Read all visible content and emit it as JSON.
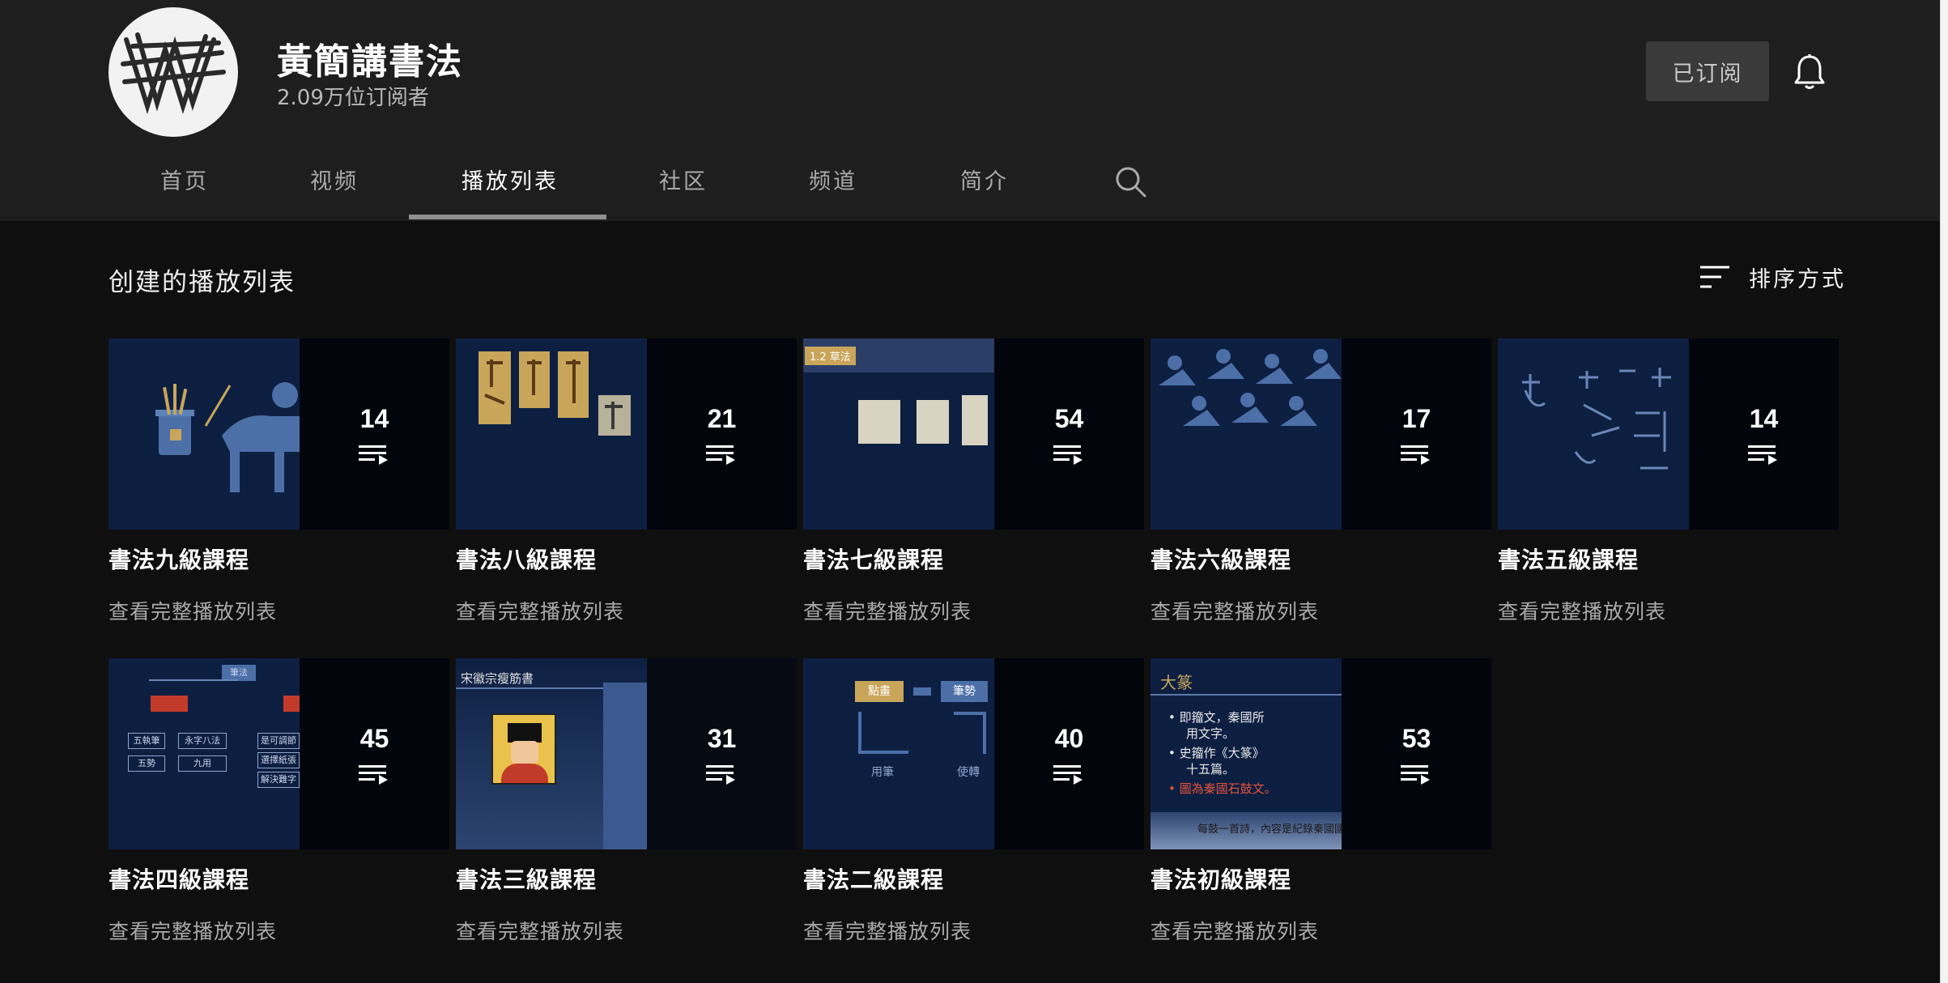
{
  "channel": {
    "name": "黃簡講書法",
    "subscribers": "2.09万位订阅者",
    "subscribed_label": "已订阅"
  },
  "tabs": [
    {
      "label": "首页",
      "active": false
    },
    {
      "label": "视频",
      "active": false
    },
    {
      "label": "播放列表",
      "active": true
    },
    {
      "label": "社区",
      "active": false
    },
    {
      "label": "频道",
      "active": false
    },
    {
      "label": "简介",
      "active": false
    }
  ],
  "icons": {
    "tab_search": "search-icon",
    "bell": "bell-icon",
    "sort": "sort-icon",
    "playlist": "playlist-icon"
  },
  "section": {
    "title": "创建的播放列表",
    "sort_label": "排序方式"
  },
  "playlists": [
    {
      "title": "書法九級課程",
      "count": "14",
      "link": "查看完整播放列表"
    },
    {
      "title": "書法八級課程",
      "count": "21",
      "link": "查看完整播放列表"
    },
    {
      "title": "書法七級課程",
      "count": "54",
      "link": "查看完整播放列表"
    },
    {
      "title": "書法六級課程",
      "count": "17",
      "link": "查看完整播放列表"
    },
    {
      "title": "書法五級課程",
      "count": "14",
      "link": "查看完整播放列表"
    },
    {
      "title": "書法四級課程",
      "count": "45",
      "link": "查看完整播放列表"
    },
    {
      "title": "書法三級課程",
      "count": "31",
      "link": "查看完整播放列表"
    },
    {
      "title": "書法二級課程",
      "count": "40",
      "link": "查看完整播放列表"
    },
    {
      "title": "書法初級課程",
      "count": "53",
      "link": "查看完整播放列表"
    }
  ],
  "thumb_text": {
    "p7_header": "1.2 草法",
    "p4_root": "筆法",
    "p4_a": "五執筆",
    "p4_b": "永字八法",
    "p4_c": "五勢",
    "p4_d": "九用",
    "p4_e": "是可調節",
    "p4_f": "選擇紙張",
    "p4_g": "解決難字",
    "p3_header": "宋徽宗瘦筋書",
    "p2_a": "點畫",
    "p2_b": "筆勢",
    "p2_c": "用筆",
    "p2_d": "使轉",
    "p1_title": "大篆",
    "p1_l1": "• 即籀文，秦國所",
    "p1_l1b": "用文字。",
    "p1_l2": "• 史籀作《大篆》",
    "p1_l2b": "十五篇。",
    "p1_l3": "• 圖為秦國石鼓文。",
    "p1_caption": "每鼓一首詩，內容是紀錄秦國國君出獵的情況"
  },
  "colors": {
    "background": "#0f0f0f",
    "header": "#1e1e1e",
    "thumb_navy": "#0d1f41",
    "thumb_blue": "#4c6fa8",
    "thumb_tan": "#c9a55a"
  }
}
